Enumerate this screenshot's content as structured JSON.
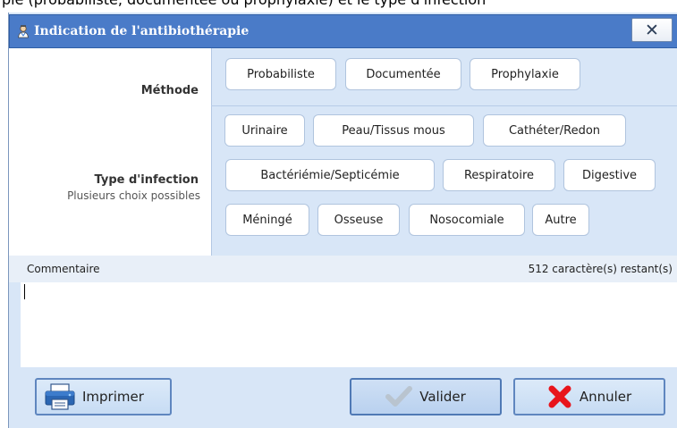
{
  "top_fragment": "pie (probabiliste, documentée ou prophylaxie) et le type d'infection",
  "dialog": {
    "title": "Indication de l'antibiothérapie",
    "close_label": "✕"
  },
  "methode": {
    "label": "Méthode",
    "options": [
      "Probabiliste",
      "Documentée",
      "Prophylaxie"
    ]
  },
  "infection": {
    "label": "Type d'infection",
    "sublabel": "Plusieurs choix possibles",
    "options": [
      "Urinaire",
      "Peau/Tissus mous",
      "Cathéter/Redon",
      "Bactériémie/Septicémie",
      "Respiratoire",
      "Digestive",
      "Méningé",
      "Osseuse",
      "Nosocomiale",
      "Autre"
    ]
  },
  "comment": {
    "label": "Commentaire",
    "remaining": "512 caractère(s) restant(s)",
    "value": ""
  },
  "buttons": {
    "print": "Imprimer",
    "validate": "Valider",
    "cancel": "Annuler"
  },
  "icons": {
    "title": "doctor-icon",
    "print": "printer-icon",
    "validate": "checkmark-icon",
    "cancel": "red-x-icon"
  },
  "colors": {
    "title_bar": "#4a7bc8",
    "panel_bg": "#d8e6f7",
    "cancel_icon": "#e8141b",
    "check_icon": "#b9c4cf"
  }
}
